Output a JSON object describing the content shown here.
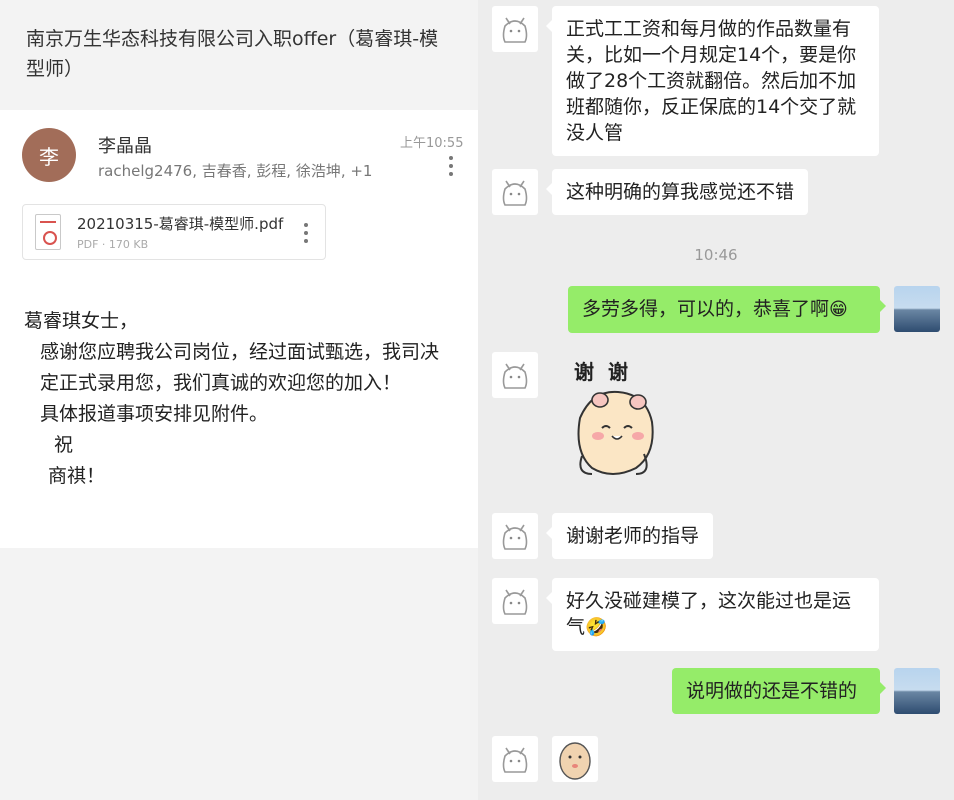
{
  "email": {
    "subject": "南京万生华态科技有限公司入职offer（葛睿琪-模型师）",
    "avatar_letter": "李",
    "sender": "李晶晶",
    "recipients": "rachelg2476, 吉春香, 彭程, 徐浩坤, +1",
    "time": "上午10:55",
    "attachment": {
      "name": "20210315-葛睿琪-模型师.pdf",
      "meta": "PDF · 170 KB"
    },
    "body": {
      "greeting": "葛睿琪女士，",
      "paragraph1": "感谢您应聘我公司岗位，经过面试甄选，我司决定正式录用您，我们真诚的欢迎您的加入！",
      "paragraph2": "具体报道事项安排见附件。",
      "closing1": "祝",
      "closing2": "商祺！"
    }
  },
  "chat": {
    "messages": [
      {
        "text": "正式工工资和每月做的作品数量有关，比如一个月规定14个，要是你做了28个工资就翻倍。然后加不加班都随你，反正保底的14个交了就没人管"
      },
      {
        "text": "这种明确的算我感觉还不错"
      },
      {
        "text": "多劳多得，可以的，恭喜了啊",
        "emoji": "😁"
      },
      {
        "sticker_text": "谢谢"
      },
      {
        "text": "谢谢老师的指导"
      },
      {
        "text": "好久没碰建模了，这次能过也是运气",
        "emoji": "🤣"
      },
      {
        "text": "说明做的还是不错的"
      }
    ],
    "timestamp": "10:46"
  }
}
